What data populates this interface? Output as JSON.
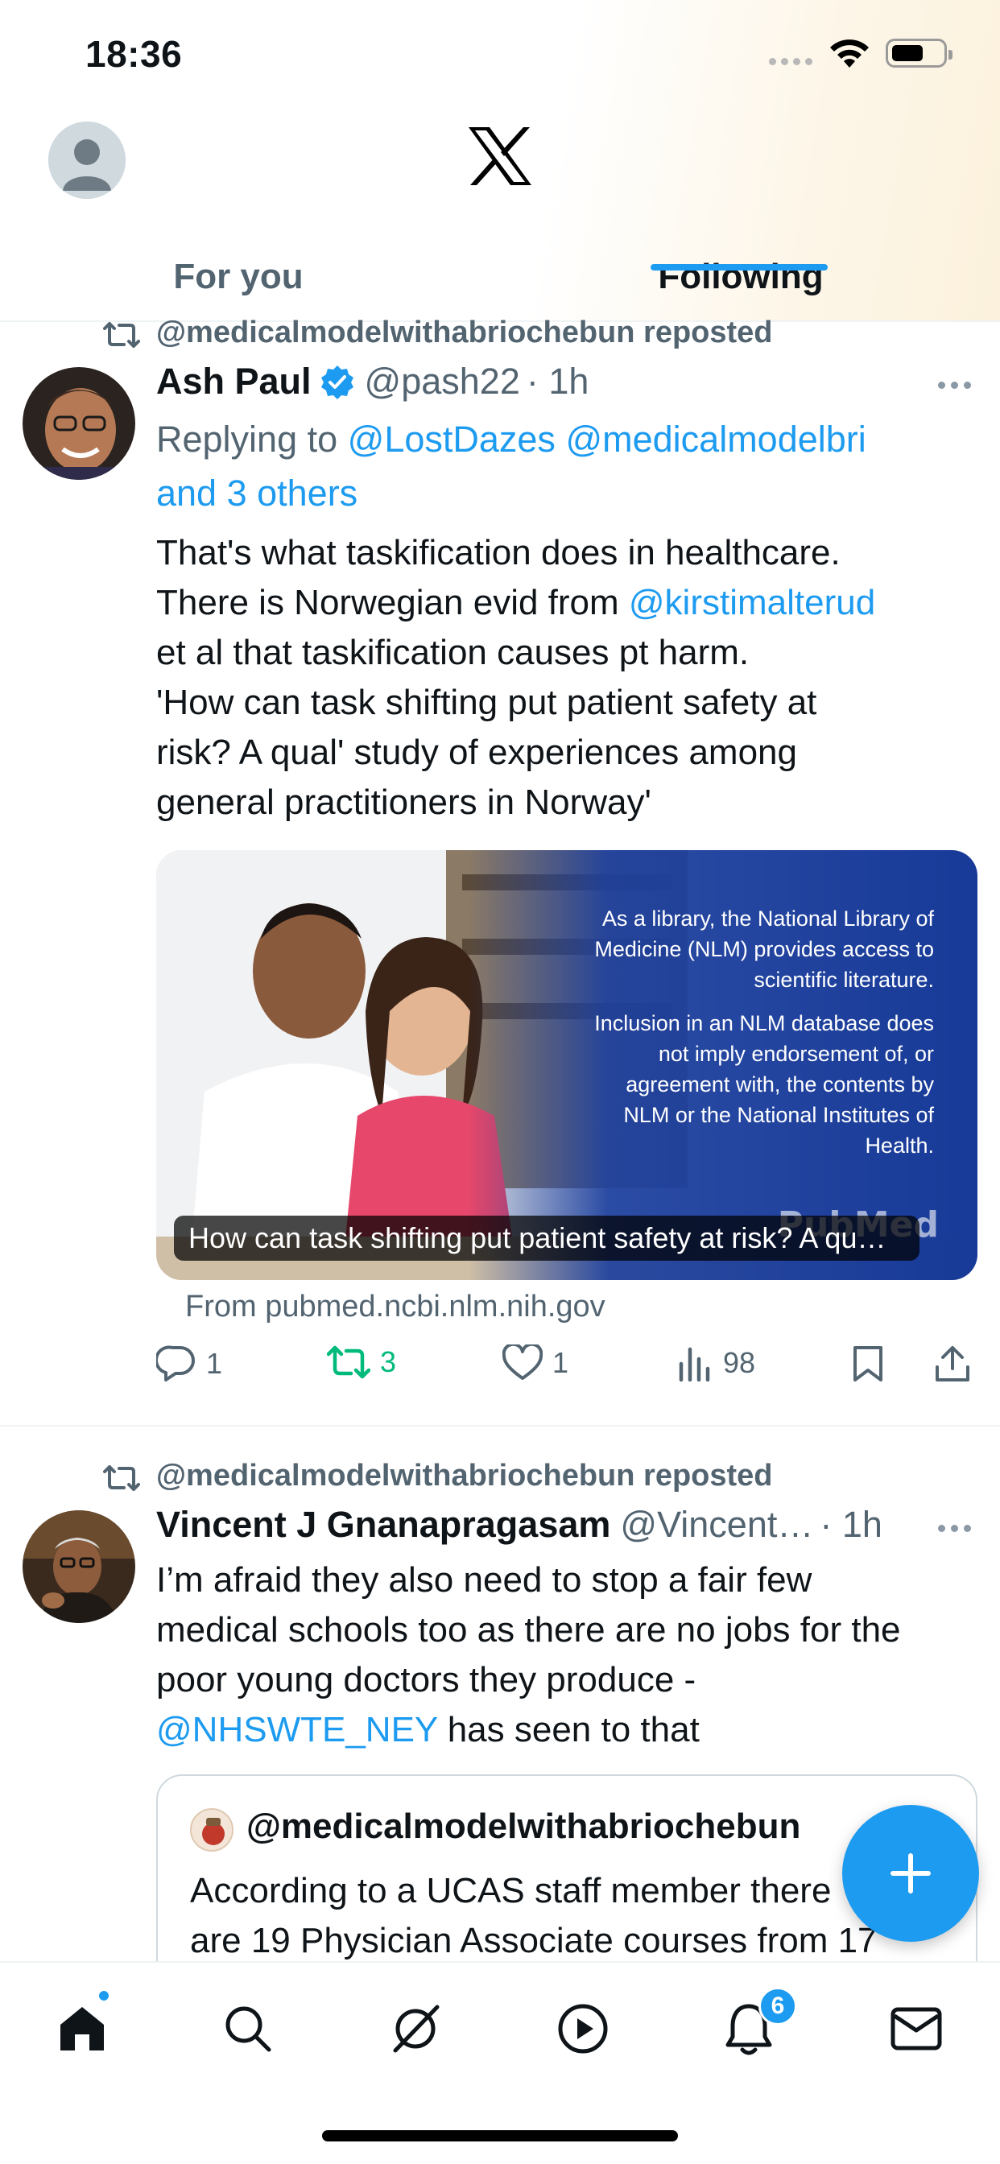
{
  "status_bar": {
    "time": "18:36"
  },
  "tabs": [
    {
      "label": "For you"
    },
    {
      "label": "Following"
    }
  ],
  "posts": [
    {
      "repost_label": "@medicalmodelwithabriochebun reposted",
      "author": "Ash Paul",
      "handle": "@pash22",
      "time": "· 1h",
      "verified": true,
      "reply_prefix": "Replying to ",
      "reply_to_1": "@LostDazes",
      "reply_to_2": "@medicalmodelbri",
      "reply_others": "and 3 others",
      "text_line1": "That's what taskification does in healthcare.",
      "text_line2_a": "There is Norwegian evid from ",
      "text_line2_link": "@kirstimalterud",
      "text_line3": "et al that taskification causes pt harm.",
      "text_line4": "'How can task shifting put patient safety at",
      "text_line5": "risk? A qual' study of experiences among",
      "text_line6": "general practitioners in Norway'",
      "card": {
        "overlay_p1": "As a library, the National Library of Medicine (NLM) provides access to scientific literature.",
        "overlay_p2": "Inclusion in an NLM database does not imply endorsement of, or agreement with, the contents by NLM or the National Institutes of Health.",
        "logo": "PubMed",
        "caption": "How can task shifting put patient safety at risk? A qu…",
        "source": "From pubmed.ncbi.nlm.nih.gov"
      },
      "actions": {
        "replies": "1",
        "reposts": "3",
        "likes": "1",
        "views": "98"
      }
    },
    {
      "repost_label": "@medicalmodelwithabriochebun reposted",
      "author": "Vincent J Gnanapragasam",
      "handle": "@Vincent…",
      "time": "· 1h",
      "text_line1": "I’m afraid they also need to stop  a fair few",
      "text_line2": "medical schools too as there are no jobs for the",
      "text_line3": "poor young doctors they produce -",
      "text_line4_link": "@NHSWTE_NEY",
      "text_line4_rest": " has seen to that",
      "quote": {
        "author": "@medicalmodelwithabriochebun",
        "text_line1": "According to a UCAS staff member there",
        "text_line2": "are 19 Physician Associate courses from 17"
      }
    }
  ],
  "bottom_nav": {
    "items": [
      "home-icon",
      "search-icon",
      "grok-icon",
      "video-icon",
      "notifications-icon",
      "messages-icon"
    ],
    "notifications_badge": "6"
  },
  "colors": {
    "accent": "#1d9bf0",
    "repost_green": "#00ba7c",
    "muted": "#536471"
  }
}
